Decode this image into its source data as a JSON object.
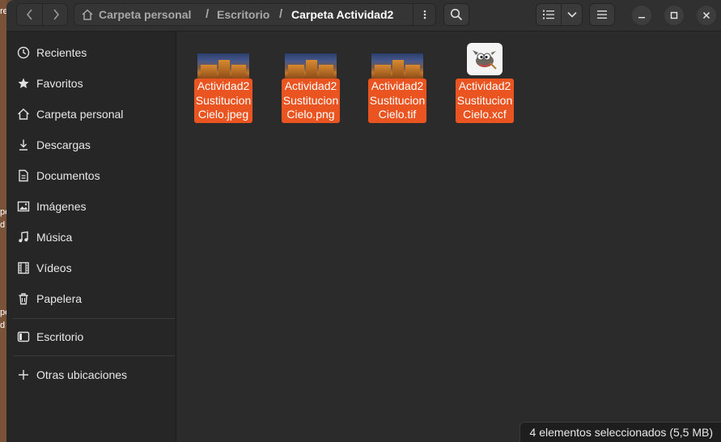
{
  "window": {
    "background_fragments": [
      "re",
      "pe",
      "d",
      "pe",
      "d"
    ]
  },
  "path": {
    "home_label": "Carpeta personal",
    "separator": "/",
    "middle_label": "Escritorio",
    "current_label": "Carpeta Actividad2"
  },
  "sidebar": {
    "items": [
      {
        "label": "Recientes",
        "icon": "clock-icon"
      },
      {
        "label": "Favoritos",
        "icon": "star-icon"
      },
      {
        "label": "Carpeta personal",
        "icon": "home-icon"
      },
      {
        "label": "Descargas",
        "icon": "download-icon"
      },
      {
        "label": "Documentos",
        "icon": "document-icon"
      },
      {
        "label": "Imágenes",
        "icon": "image-icon"
      },
      {
        "label": "Música",
        "icon": "music-icon"
      },
      {
        "label": "Vídeos",
        "icon": "video-icon"
      },
      {
        "label": "Papelera",
        "icon": "trash-icon"
      }
    ],
    "desktop": {
      "label": "Escritorio",
      "icon": "drive-icon"
    },
    "other": {
      "label": "Otras ubicaciones",
      "icon": "plus-icon"
    }
  },
  "files": [
    {
      "line1": "Actividad2",
      "line2": "Sustitucion",
      "line3": "Cielo.jpeg",
      "kind": "photo"
    },
    {
      "line1": "Actividad2",
      "line2": "Sustitucion",
      "line3": "Cielo.png",
      "kind": "photo"
    },
    {
      "line1": "Actividad2",
      "line2": "Sustitucion",
      "line3": "Cielo.tif",
      "kind": "photo"
    },
    {
      "line1": "Actividad2",
      "line2": "Sustitucion",
      "line3": "Cielo.xcf",
      "kind": "gimp"
    }
  ],
  "status": {
    "text": "4 elementos seleccionados  (5,5 MB)"
  },
  "colors": {
    "accent": "#e95420",
    "window_bg": "#2b2b2b",
    "sidebar_bg": "#262626"
  }
}
